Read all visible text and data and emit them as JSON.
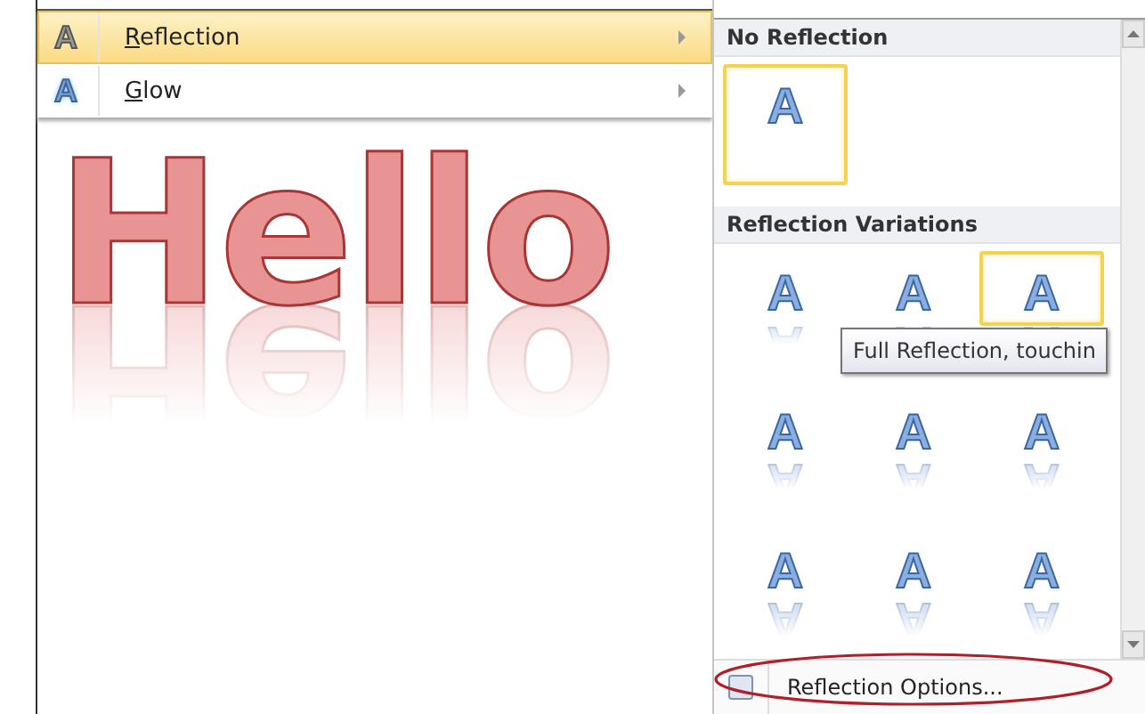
{
  "menu": {
    "items": [
      {
        "label": "Reflection",
        "icon_glyph": "A",
        "kind": "reflection",
        "selected": true
      },
      {
        "label": "Glow",
        "icon_glyph": "A",
        "kind": "glow",
        "selected": false
      }
    ]
  },
  "document": {
    "wordart": "Hello"
  },
  "gallery": {
    "sections": [
      {
        "title": "No Reflection",
        "tiles": [
          {
            "glyph": "A",
            "kind": "none",
            "selected": true
          }
        ]
      },
      {
        "title": "Reflection Variations",
        "tiles": [
          {
            "glyph": "A",
            "kind": "reflection",
            "selected": false
          },
          {
            "glyph": "A",
            "kind": "reflection",
            "selected": false
          },
          {
            "glyph": "A",
            "kind": "reflection",
            "selected": true
          },
          {
            "glyph": "A",
            "kind": "reflection",
            "selected": false
          },
          {
            "glyph": "A",
            "kind": "reflection",
            "selected": false
          },
          {
            "glyph": "A",
            "kind": "reflection",
            "selected": false
          },
          {
            "glyph": "A",
            "kind": "reflection",
            "selected": false
          },
          {
            "glyph": "A",
            "kind": "reflection",
            "selected": false
          },
          {
            "glyph": "A",
            "kind": "reflection",
            "selected": false
          }
        ]
      }
    ],
    "tooltip": "Full Reflection, touchin",
    "footer": {
      "label": "Reflection Options..."
    }
  }
}
